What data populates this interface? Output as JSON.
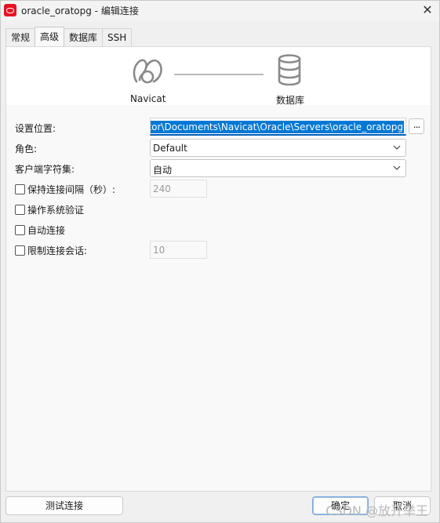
{
  "window": {
    "title": "oracle_oratopg - 编辑连接",
    "close_glyph": "✕"
  },
  "tabs": [
    {
      "label": "常规",
      "active": false
    },
    {
      "label": "高级",
      "active": true
    },
    {
      "label": "数据库",
      "active": false
    },
    {
      "label": "SSH",
      "active": false
    }
  ],
  "diagram": {
    "left_label": "Navicat",
    "right_label": "数据库"
  },
  "form": {
    "settings_location": {
      "label": "设置位置:",
      "value": "ator\\Documents\\Navicat\\Oracle\\Servers\\oracle_oratopg",
      "browse_label": "..."
    },
    "role": {
      "label": "角色:",
      "value": "Default"
    },
    "client_charset": {
      "label": "客户端字符集:",
      "value": "自动"
    },
    "keepalive": {
      "label": "保持连接间隔（秒）:",
      "checked": false,
      "value": "240"
    },
    "os_auth": {
      "label": "操作系统验证",
      "checked": false
    },
    "auto_connect": {
      "label": "自动连接",
      "checked": false
    },
    "limit_sessions": {
      "label": "限制连接会话:",
      "checked": false,
      "value": "10"
    }
  },
  "buttons": {
    "test": "测试连接",
    "ok": "确定",
    "cancel": "取消"
  },
  "watermark": "CSDN @放开举王",
  "colors": {
    "accent": "#0078d4",
    "app_icon": "#e81123"
  }
}
